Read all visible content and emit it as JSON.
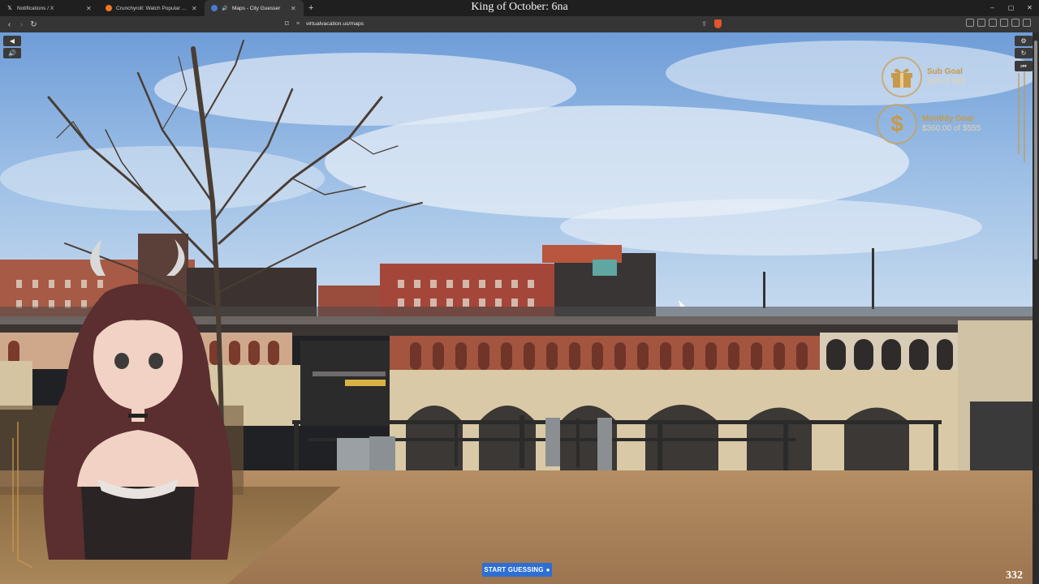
{
  "tabs": [
    {
      "title": "Notifications / X",
      "icon": "x-logo-icon",
      "active": false
    },
    {
      "title": "Crunchyroll: Watch Popular Anime, P",
      "icon": "crunchyroll-icon",
      "active": false
    },
    {
      "title": "Maps - City Guesser",
      "icon": "maps-icon",
      "active": true
    }
  ],
  "new_tab_label": "+",
  "stream_title": "King of October: 6na",
  "window_controls": {
    "minimize": "–",
    "maximize": "▢",
    "close": "✕"
  },
  "address_bar": {
    "url": "virtualvacation.us/maps"
  },
  "goals": {
    "sub": {
      "title": "Sub Goal",
      "value": "340 of 555"
    },
    "monthly": {
      "title": "Monthly Goal",
      "value": "$360.00 of $555"
    }
  },
  "start_button": {
    "label": "START GUESSING"
  },
  "counter": "332",
  "colors": {
    "accent_gold": "#c79a4a",
    "start_blue": "#2d6fd3"
  }
}
